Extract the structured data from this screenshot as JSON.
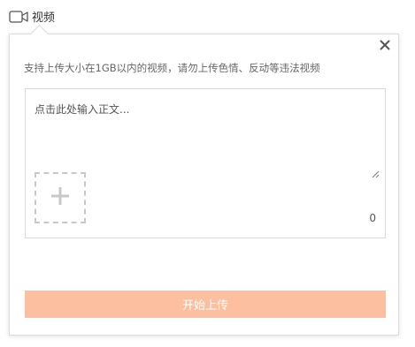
{
  "tab": {
    "label": "视频",
    "icon": "video-camera-icon"
  },
  "popup": {
    "close_icon": "close-icon",
    "hint": "支持上传大小在1GB以内的视频，请勿上传色情、反动等违法视频",
    "editor": {
      "placeholder": "点击此处输入正文...",
      "value": "",
      "char_count": "0"
    },
    "add_video_icon": "plus-icon",
    "upload_button": "开始上传"
  },
  "colors": {
    "upload_button_bg": "#fcc0a0",
    "border": "#dcdcdc",
    "hint_text": "#666666"
  }
}
